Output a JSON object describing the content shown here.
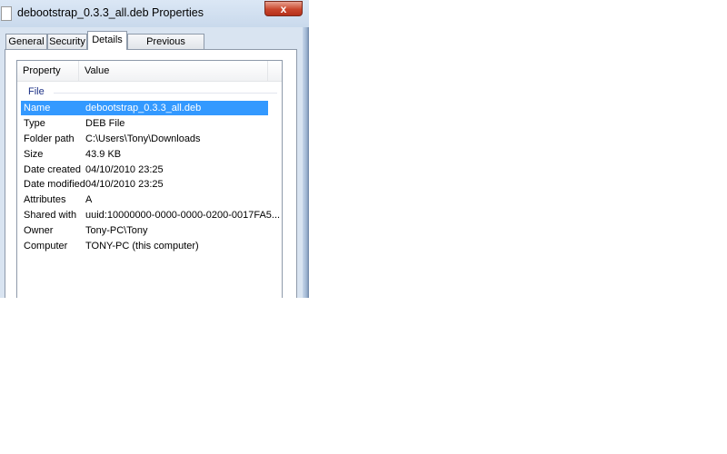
{
  "window": {
    "title": "debootstrap_0.3.3_all.deb Properties",
    "close_glyph": "x",
    "close_color": "#c9462d"
  },
  "tabs": [
    {
      "label": "General"
    },
    {
      "label": "Security"
    },
    {
      "label": "Details",
      "active": true
    },
    {
      "label": "Previous Versions"
    }
  ],
  "list": {
    "headers": {
      "property": "Property",
      "value": "Value"
    },
    "group": "File",
    "selection_color": "#3399ff",
    "rows": [
      {
        "property": "Name",
        "value": "debootstrap_0.3.3_all.deb",
        "selected": true
      },
      {
        "property": "Type",
        "value": "DEB File"
      },
      {
        "property": "Folder path",
        "value": "C:\\Users\\Tony\\Downloads"
      },
      {
        "property": "Size",
        "value": "43.9 KB"
      },
      {
        "property": "Date created",
        "value": "04/10/2010 23:25"
      },
      {
        "property": "Date modified",
        "value": "04/10/2010 23:25"
      },
      {
        "property": "Attributes",
        "value": "A"
      },
      {
        "property": "Shared with",
        "value": "uuid:10000000-0000-0000-0200-0017FA5..."
      },
      {
        "property": "Owner",
        "value": "Tony-PC\\Tony"
      },
      {
        "property": "Computer",
        "value": "TONY-PC (this computer)"
      }
    ]
  },
  "icons": {
    "title_icon": "file-icon",
    "close": "close-icon"
  }
}
